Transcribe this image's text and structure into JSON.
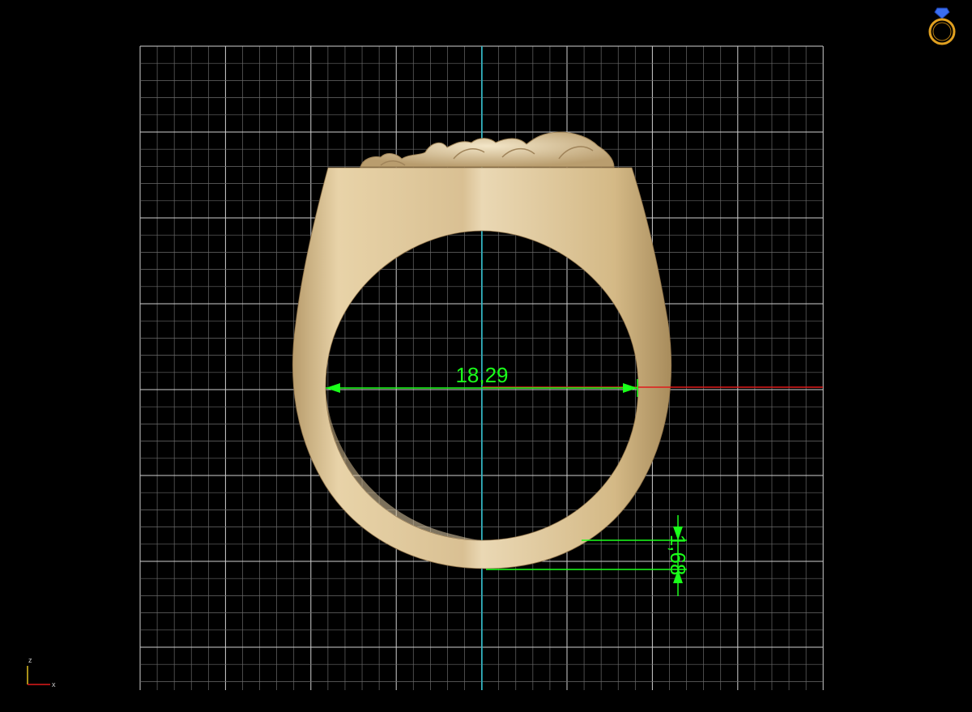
{
  "viewport": {
    "background": "#000000",
    "grid_color": "#cfcfcf",
    "grid_minor_color": "#6a6a6a",
    "axis_vertical_color": "#20b8c8",
    "axis_horizontal_color": "#e01a1a"
  },
  "model": {
    "name": "signet-ring",
    "metal_color": "#d8bf94",
    "front_view": true
  },
  "dimensions": {
    "inner_diameter": "18,29",
    "shank_thickness": "1,68",
    "color": "#1aff1a"
  },
  "axis_indicator": {
    "z_label": "z",
    "x_label": "x",
    "x_color": "#e01a1a",
    "z_color": "#e0c020"
  },
  "logo": {
    "icon": "ring-icon",
    "color": "#e0a020",
    "gem_color": "#3a6ef0"
  }
}
